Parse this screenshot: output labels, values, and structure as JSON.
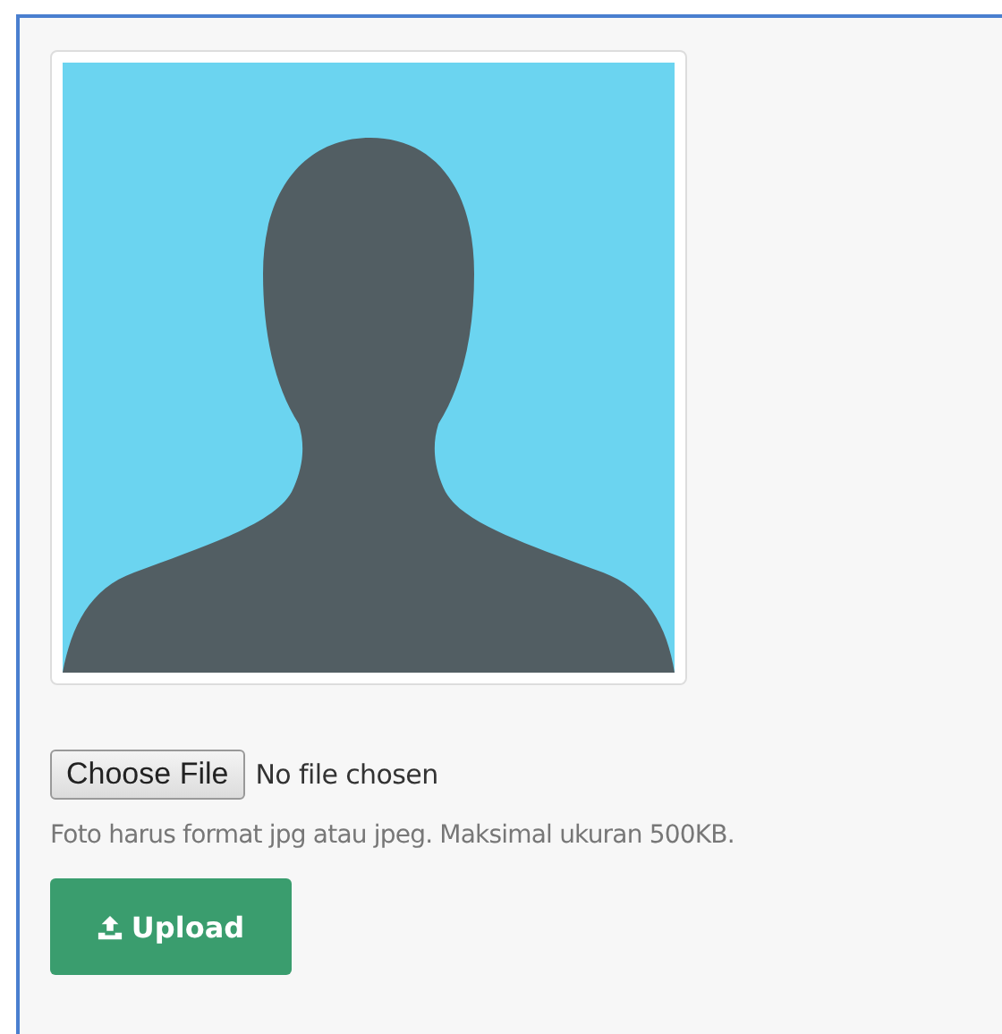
{
  "file_input": {
    "button": "Choose File",
    "status": "No file chosen"
  },
  "hint": "Foto harus format jpg atau jpeg. Maksimal ukuran 500KB.",
  "upload_button": {
    "label": "Upload"
  }
}
